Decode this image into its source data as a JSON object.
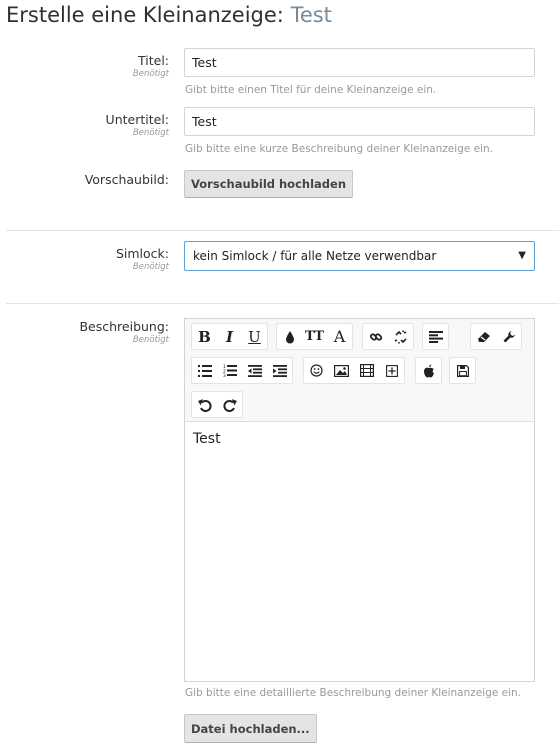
{
  "header": {
    "title_prefix": "Erstelle eine Kleinanzeige:",
    "title_subject": "Test"
  },
  "required_label": "Benötigt",
  "fields": {
    "title": {
      "label": "Titel:",
      "value": "Test",
      "hint": "Gibt bitte einen Titel für deine Kleinanzeige ein."
    },
    "subtitle": {
      "label": "Untertitel:",
      "value": "Test",
      "hint": "Gib bitte eine kurze Beschreibung deiner Kleinanzeige ein."
    },
    "preview_image": {
      "label": "Vorschaubild:",
      "button_label": "Vorschaubild hochladen"
    },
    "simlock": {
      "label": "Simlock:",
      "selected": "kein Simlock / für alle Netze verwendbar"
    },
    "description": {
      "label": "Beschreibung:",
      "content": "Test",
      "hint": "Gib bitte eine detaillierte Beschreibung deiner Kleinanzeige ein."
    }
  },
  "toolbar": {
    "bold": "B",
    "italic": "I",
    "underline": "U",
    "font_size": "TT",
    "font_family": "A"
  },
  "upload_button_label": "Datei hochladen...",
  "icons": {
    "toolbar_row1": [
      "bold-icon",
      "italic-icon",
      "underline-icon",
      "text-color-icon",
      "font-size-icon",
      "font-family-icon",
      "link-icon",
      "unlink-icon",
      "align-icon",
      "remove-format-icon",
      "wrench-icon"
    ],
    "toolbar_row2": [
      "bullet-list-icon",
      "numbered-list-icon",
      "outdent-icon",
      "indent-icon",
      "smiley-icon",
      "image-icon",
      "media-icon",
      "insert-icon",
      "apple-icon",
      "save-draft-icon"
    ],
    "toolbar_row3": [
      "undo-icon",
      "redo-icon"
    ]
  },
  "colors": {
    "accent": "#5ba2d8",
    "title_subject": "#7a8a99",
    "hint": "#999999",
    "button_bg": "#e4e4e4"
  }
}
